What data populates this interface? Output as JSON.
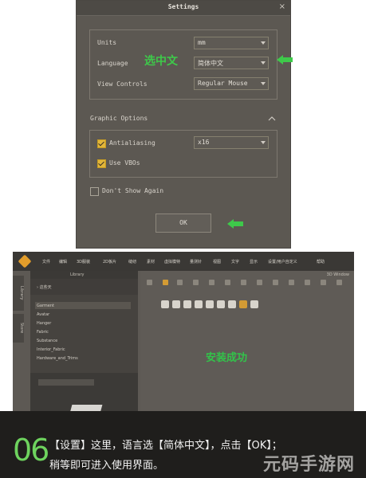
{
  "settings": {
    "title": "Settings",
    "close": "×",
    "rows": [
      {
        "label": "Units",
        "value": "mm"
      },
      {
        "label": "Language",
        "value": "简体中文"
      },
      {
        "label": "View Controls",
        "value": "Regular Mouse"
      }
    ],
    "annotation": "选中文",
    "graphic_options": {
      "title": "Graphic Options",
      "antialiasing_label": "Antialiasing",
      "antialiasing_value": "x16",
      "vbo_label": "Use VBOs"
    },
    "dont_show_label": "Don't Show Again",
    "ok_label": "OK"
  },
  "app": {
    "menu": [
      "文件",
      "编辑",
      "3D服装",
      "2D板片",
      "缝纫",
      "素材",
      "虚拟模特",
      "量测针",
      "视图",
      "文字",
      "显示",
      "设置/用户自定义",
      "帮助"
    ],
    "side_tabs": [
      "Library",
      "Store"
    ],
    "library": {
      "title": "Library",
      "subheader": "› 这些天",
      "items": [
        "Garment",
        "Avatar",
        "Hanger",
        "Fabric",
        "Substance",
        "Interior_Fabric",
        "Hardware_and_Trims"
      ]
    },
    "window_title": "3D Window",
    "success_text": "安装成功"
  },
  "caption": {
    "step": "06",
    "line1": "【设置】这里，语言选【简体中文】，点击【OK】；",
    "line2": "稍等即可进入使用界面。"
  },
  "watermark": "元码手游网",
  "colors": {
    "annotation_green": "#3ec94a",
    "checkbox_yellow": "#e2b63a",
    "step_green": "#6ed35e"
  }
}
